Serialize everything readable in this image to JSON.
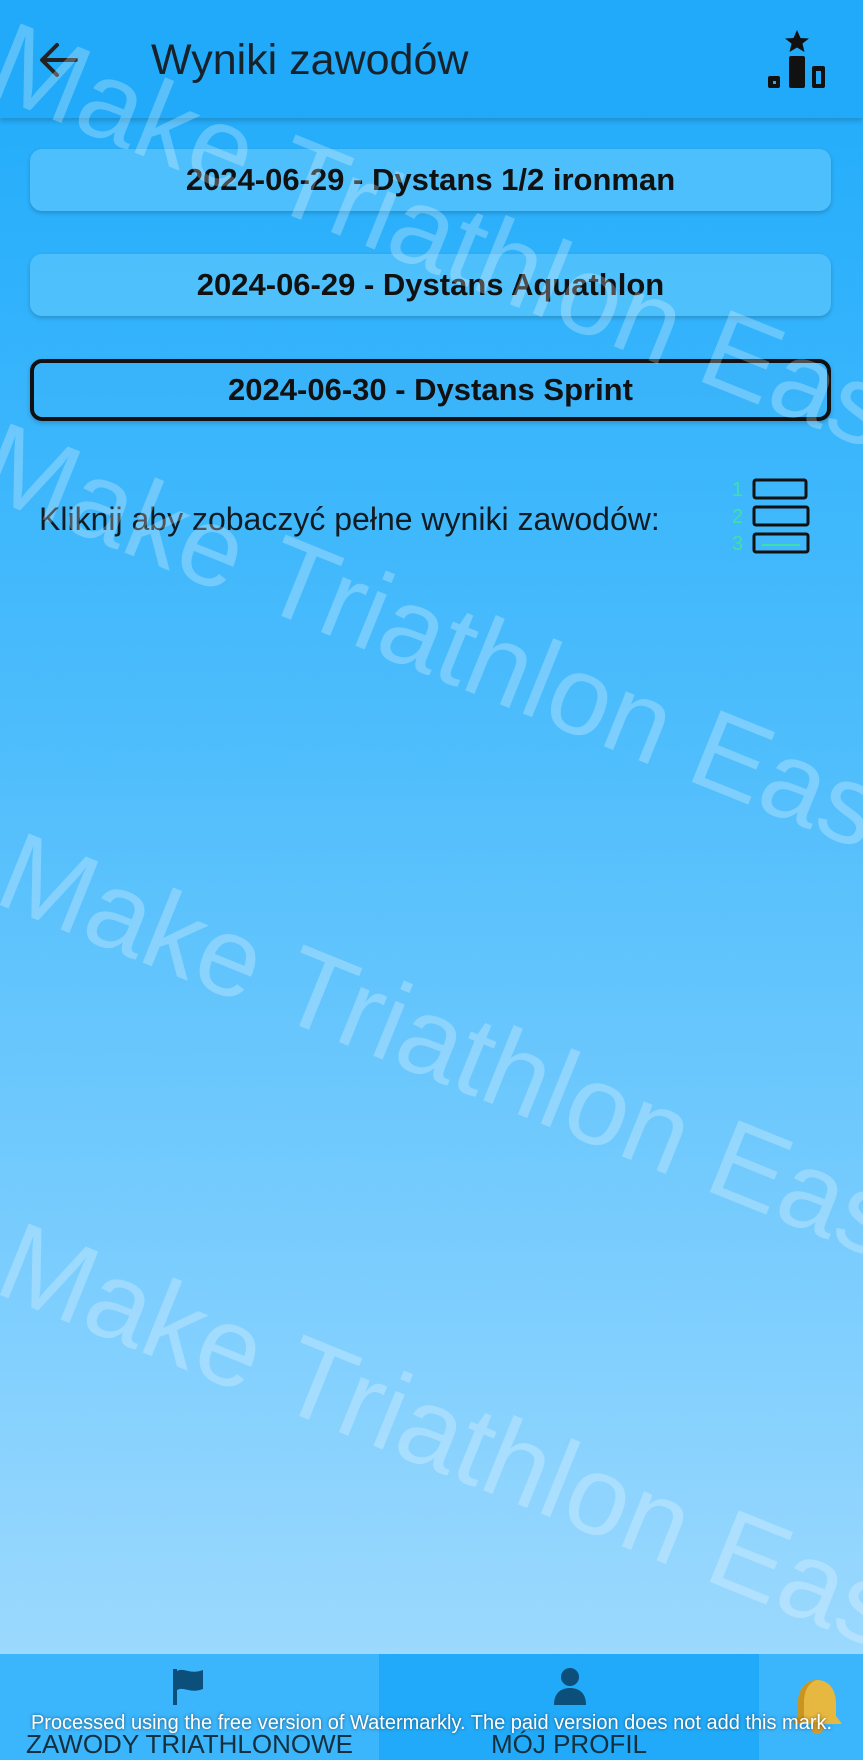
{
  "appbar": {
    "title": "Wyniki zawodów",
    "back_icon": "arrow-left-icon",
    "action_icon": "podium-icon"
  },
  "races": [
    {
      "label": "2024-06-29 - Dystans 1/2 ironman",
      "selected": false
    },
    {
      "label": "2024-06-29 - Dystans Aquathlon",
      "selected": false
    },
    {
      "label": "2024-06-30 - Dystans Sprint",
      "selected": true
    }
  ],
  "hint": {
    "text": "Kliknij aby zobaczyć pełne wyniki zawodów:",
    "icon": "ranking-list-icon",
    "ranks": [
      "1",
      "2",
      "3"
    ]
  },
  "watermark": {
    "text": "Make Triathlon Easier"
  },
  "bottom_nav": {
    "items": [
      {
        "label": "ZAWODY TRIATHLONOWE",
        "icon": "flag-icon"
      },
      {
        "label": "MÓJ PROFIL",
        "icon": "person-icon"
      },
      {
        "label": "",
        "icon": "bell-icon"
      }
    ]
  },
  "footer_note": "Processed using the free version of Watermarkly. The paid version does not add this mark.",
  "colors": {
    "appbar": "#21aaf9",
    "text_dark": "#17222b",
    "rank_green": "#3fe0a8",
    "bell_gold": "#e6b840"
  }
}
